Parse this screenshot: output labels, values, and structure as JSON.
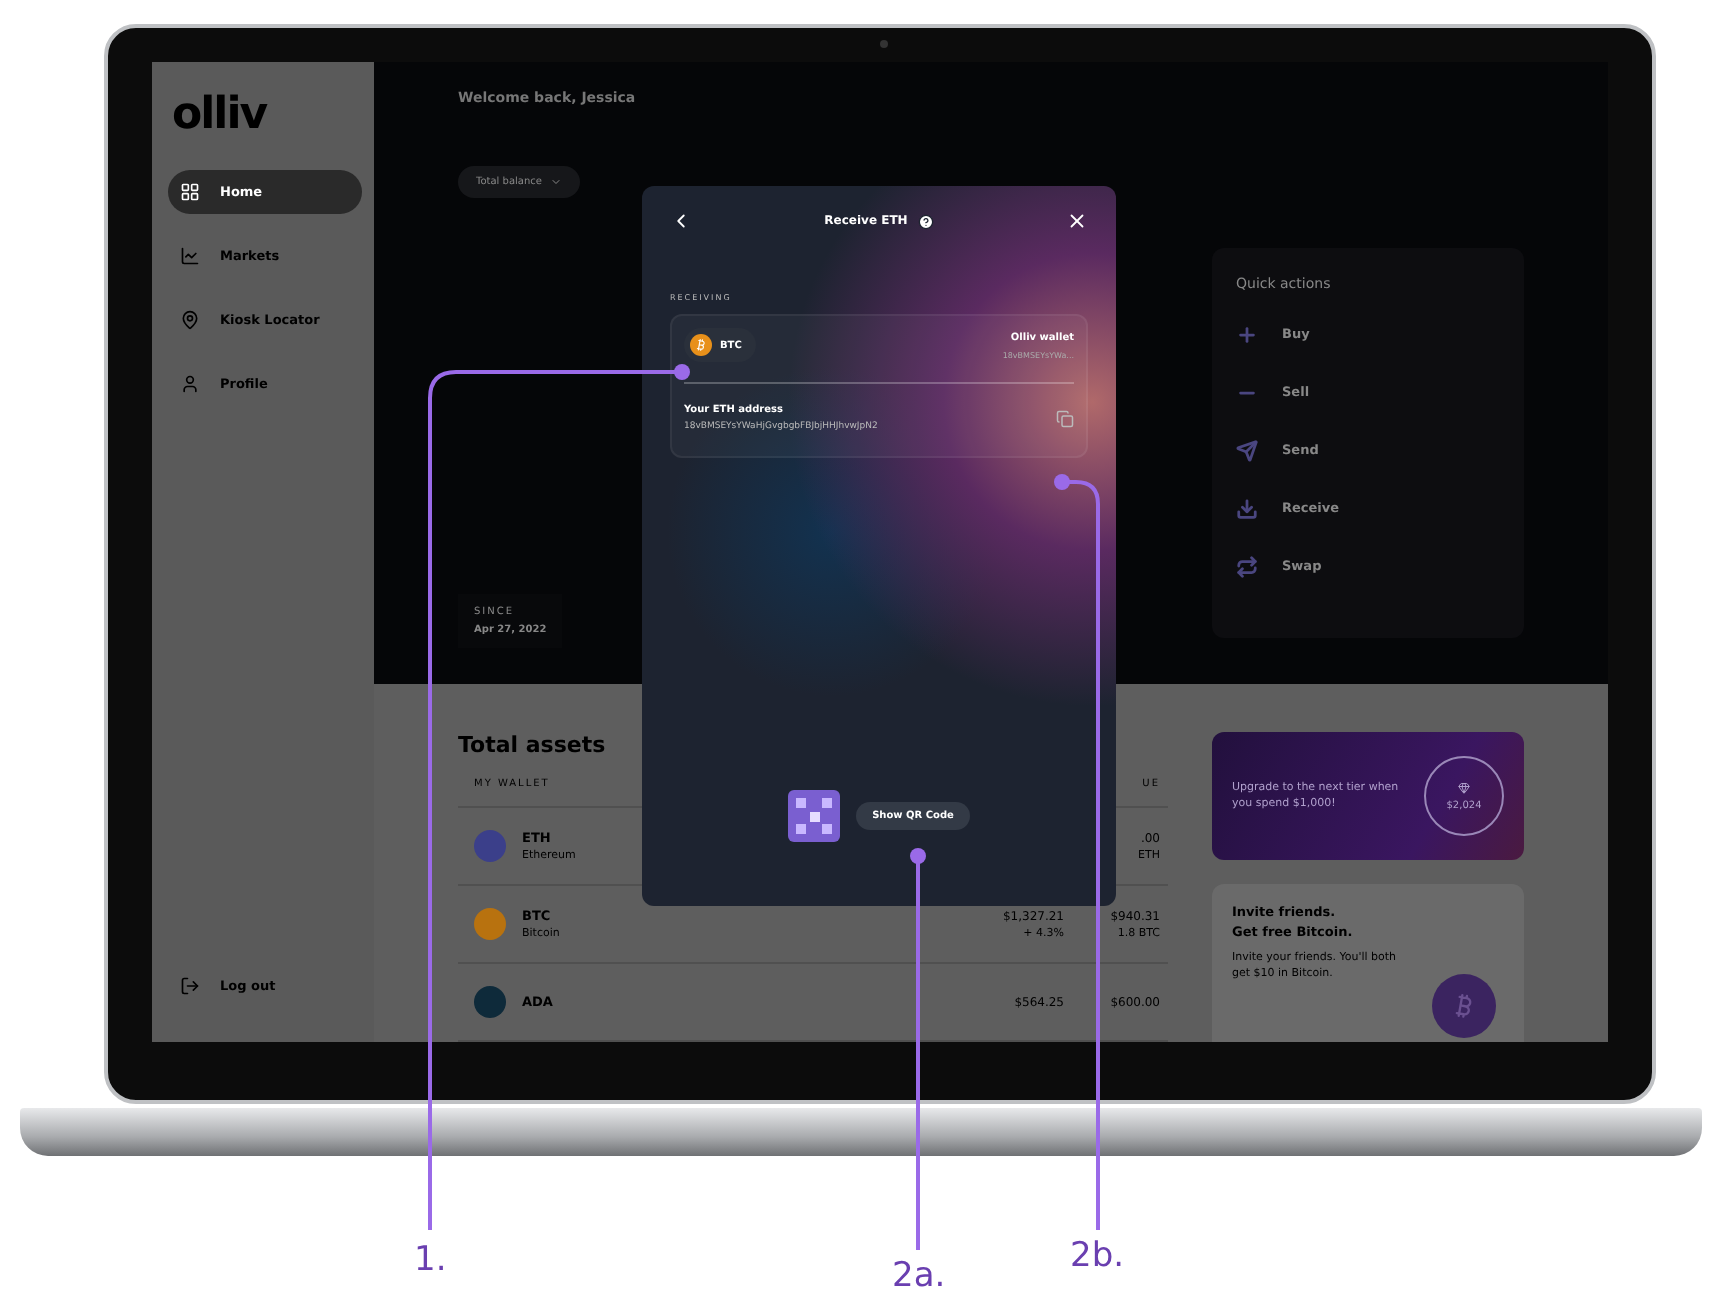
{
  "sidebar": {
    "logo": "olliv",
    "items": [
      {
        "label": "Home",
        "selected": true
      },
      {
        "label": "Markets",
        "selected": false
      },
      {
        "label": "Kiosk Locator",
        "selected": false
      },
      {
        "label": "Profile",
        "selected": false
      }
    ],
    "logout": "Log out"
  },
  "header": {
    "greeting": "Welcome back, Jessica",
    "balance_dropdown": "Total balance"
  },
  "since": {
    "label": "SINCE",
    "date": "Apr 27, 2022"
  },
  "quick_actions": {
    "title": "Quick actions",
    "items": [
      {
        "label": "Buy"
      },
      {
        "label": "Sell"
      },
      {
        "label": "Send"
      },
      {
        "label": "Receive"
      },
      {
        "label": "Swap"
      }
    ]
  },
  "assets": {
    "title": "Total assets",
    "column_1": "MY WALLET",
    "column_3": "UE",
    "rows": [
      {
        "symbol": "ETH",
        "name": "Ethereum",
        "color": "#3b3f8a",
        "value": ".00",
        "amount": "ETH"
      },
      {
        "symbol": "BTC",
        "name": "Bitcoin",
        "color": "#b8720f",
        "price": "$1,327.21",
        "change": "+ 4.3%",
        "value": "$940.31",
        "amount": "1.8 BTC"
      },
      {
        "symbol": "ADA",
        "color": "#0e2a3a",
        "price": "$564.25",
        "value": "$600.00"
      }
    ]
  },
  "upgrade": {
    "text": "Upgrade to the next tier when you spend $1,000!",
    "ring_value": "$2,024"
  },
  "invite": {
    "title": "Invite friends.",
    "subtitle": "Get free Bitcoin.",
    "text": "Invite your friends. You'll both get $10 in Bitcoin."
  },
  "modal": {
    "title": "Receive ETH",
    "section": "RECEIVING",
    "coin": "BTC",
    "wallet_name": "Olliv wallet",
    "wallet_address": "18vBMSEYsYWa...",
    "address_label": "Your ETH address",
    "address": "18vBMSEYsYWaHjGvgbgbFBJbjHHJhvwJpN2",
    "qr_button": "Show QR Code"
  },
  "annotations": [
    {
      "label": "1."
    },
    {
      "label": "2a."
    },
    {
      "label": "2b."
    }
  ]
}
